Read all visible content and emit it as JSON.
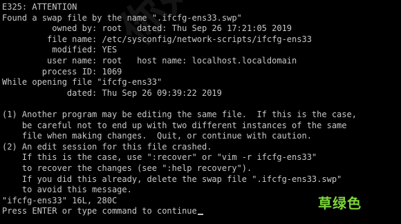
{
  "terminal": {
    "lines": [
      "E325: ATTENTION",
      "Found a swap file by the name \".ifcfg-ens33.swp\"",
      "          owned by: root   dated: Thu Sep 26 17:21:05 2019",
      "         file name: /etc/sysconfig/network-scripts/ifcfg-ens33",
      "          modified: YES",
      "         user name: root   host name: localhost.localdomain",
      "        process ID: 1069",
      "While opening file \"ifcfg-ens33\"",
      "             dated: Thu Sep 26 09:39:22 2019",
      "",
      "(1) Another program may be editing the same file.  If this is the case,",
      "    be careful not to end up with two different instances of the same",
      "    file when making changes.  Quit, or continue with caution.",
      "(2) An edit session for this file crashed.",
      "    If this is the case, use \":recover\" or \"vim -r ifcfg-ens33\"",
      "    to recover the changes (see \":help recovery\").",
      "    If you did this already, delete the swap file \".ifcfg-ens33.swp\"",
      "    to avoid this message.",
      "\"ifcfg-ens33\" 16L, 280C",
      "Press ENTER or type command to continue"
    ]
  },
  "overlay": {
    "brand_text": "草绿色",
    "watermark_text": "你好吗乡一"
  },
  "colors": {
    "background": "#000000",
    "text": "#c8c8c8",
    "brand": "#7ed43b"
  }
}
